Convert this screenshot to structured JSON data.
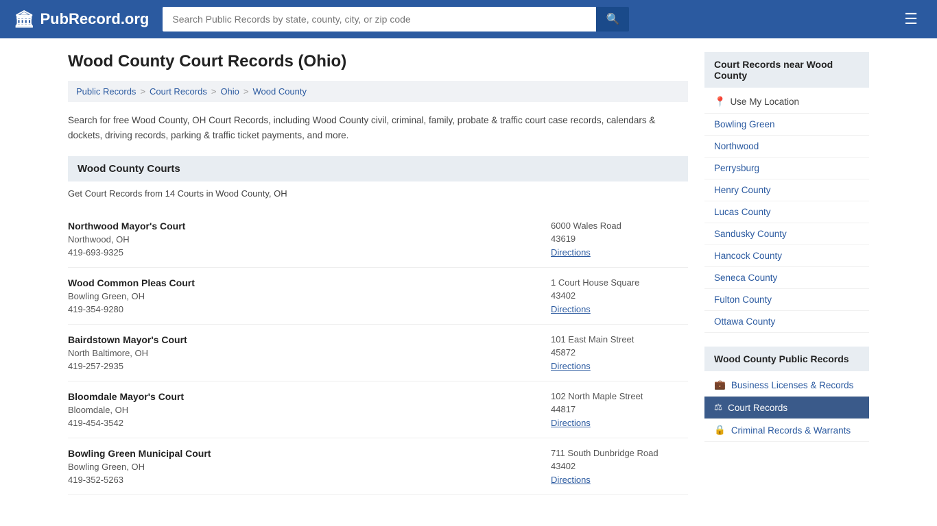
{
  "header": {
    "logo_text": "PubRecord.org",
    "logo_icon": "🏛",
    "search_placeholder": "Search Public Records by state, county, city, or zip code",
    "search_button_icon": "🔍",
    "menu_icon": "☰"
  },
  "page": {
    "title": "Wood County Court Records (Ohio)",
    "description": "Search for free Wood County, OH Court Records, including Wood County civil, criminal, family, probate & traffic court case records, calendars & dockets, driving records, parking & traffic ticket payments, and more.",
    "section_title": "Wood County Courts",
    "courts_count": "Get Court Records from 14 Courts in Wood County, OH"
  },
  "breadcrumb": {
    "items": [
      {
        "label": "Public Records",
        "href": "#"
      },
      {
        "label": "Court Records",
        "href": "#"
      },
      {
        "label": "Ohio",
        "href": "#"
      },
      {
        "label": "Wood County",
        "href": "#"
      }
    ]
  },
  "courts": [
    {
      "name": "Northwood Mayor's Court",
      "city": "Northwood, OH",
      "phone": "419-693-9325",
      "address": "6000 Wales Road",
      "zip": "43619",
      "directions_label": "Directions"
    },
    {
      "name": "Wood Common Pleas Court",
      "city": "Bowling Green, OH",
      "phone": "419-354-9280",
      "address": "1 Court House Square",
      "zip": "43402",
      "directions_label": "Directions"
    },
    {
      "name": "Bairdstown Mayor's Court",
      "city": "North Baltimore, OH",
      "phone": "419-257-2935",
      "address": "101 East Main Street",
      "zip": "45872",
      "directions_label": "Directions"
    },
    {
      "name": "Bloomdale Mayor's Court",
      "city": "Bloomdale, OH",
      "phone": "419-454-3542",
      "address": "102 North Maple Street",
      "zip": "44817",
      "directions_label": "Directions"
    },
    {
      "name": "Bowling Green Municipal Court",
      "city": "Bowling Green, OH",
      "phone": "419-352-5263",
      "address": "711 South Dunbridge Road",
      "zip": "43402",
      "directions_label": "Directions"
    }
  ],
  "sidebar": {
    "nearby_title": "Court Records near Wood County",
    "nearby_items": [
      {
        "label": "Use My Location",
        "icon": "📍",
        "is_location": true
      },
      {
        "label": "Bowling Green"
      },
      {
        "label": "Northwood"
      },
      {
        "label": "Perrysburg"
      },
      {
        "label": "Henry County"
      },
      {
        "label": "Lucas County"
      },
      {
        "label": "Sandusky County"
      },
      {
        "label": "Hancock County"
      },
      {
        "label": "Seneca County"
      },
      {
        "label": "Fulton County"
      },
      {
        "label": "Ottawa County"
      }
    ],
    "public_records_title": "Wood County Public Records",
    "public_records_items": [
      {
        "label": "Business Licenses & Records",
        "icon": "💼"
      },
      {
        "label": "Court Records",
        "icon": "⚖",
        "active": true
      },
      {
        "label": "Criminal Records & Warrants",
        "icon": "🔒"
      }
    ]
  }
}
